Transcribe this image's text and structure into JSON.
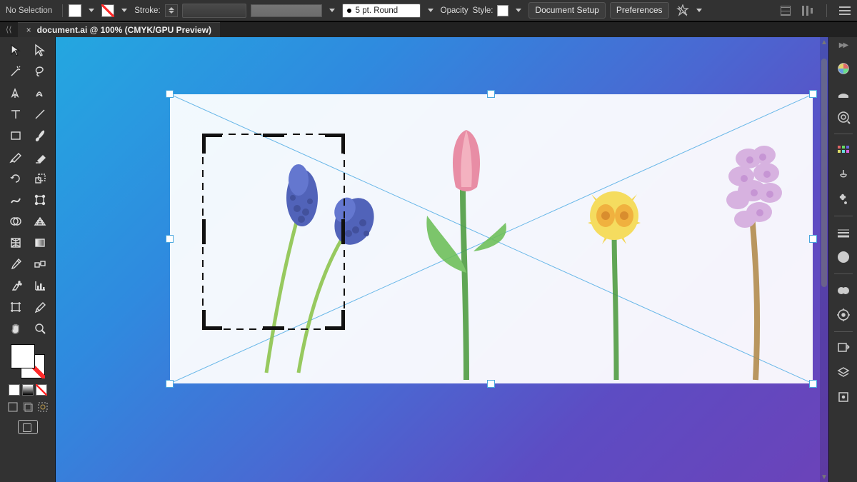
{
  "topbar": {
    "selection_label": "No Selection",
    "stroke_label": "Stroke:",
    "brush_label": "5 pt. Round",
    "opacity_label": "Opacity",
    "style_label": "Style:",
    "btn_doc_setup": "Document Setup",
    "btn_prefs": "Preferences"
  },
  "document": {
    "tab_title": "document.ai @ 100% (CMYK/GPU Preview)",
    "close_glyph": "×"
  },
  "tools": {
    "names": [
      "selection-tool",
      "direct-selection-tool",
      "magic-wand-tool",
      "lasso-tool",
      "pen-tool",
      "curvature-tool",
      "type-tool",
      "line-segment-tool",
      "rectangle-tool",
      "paintbrush-tool",
      "shaper-tool",
      "eraser-tool",
      "rotate-tool",
      "scale-tool",
      "width-tool",
      "free-transform-tool",
      "shape-builder-tool",
      "perspective-grid-tool",
      "mesh-tool",
      "gradient-tool",
      "eyedropper-tool",
      "blend-tool",
      "symbol-sprayer-tool",
      "column-graph-tool",
      "artboard-tool",
      "slice-tool",
      "hand-tool",
      "zoom-tool"
    ]
  },
  "right_panels": {
    "names": [
      "collapse",
      "color-panel",
      "shape-panel",
      "swatches-panel",
      "links-panel",
      "symbols-panel",
      "suit-panel",
      "stroke-panel",
      "circle-panel",
      "cc-libraries-panel",
      "settings-panel",
      "export-panel",
      "layers-panel",
      "appearance-panel"
    ]
  },
  "canvas": {
    "colors": {
      "bg_from": "#24a7e0",
      "bg_to": "#6b43b9"
    }
  }
}
